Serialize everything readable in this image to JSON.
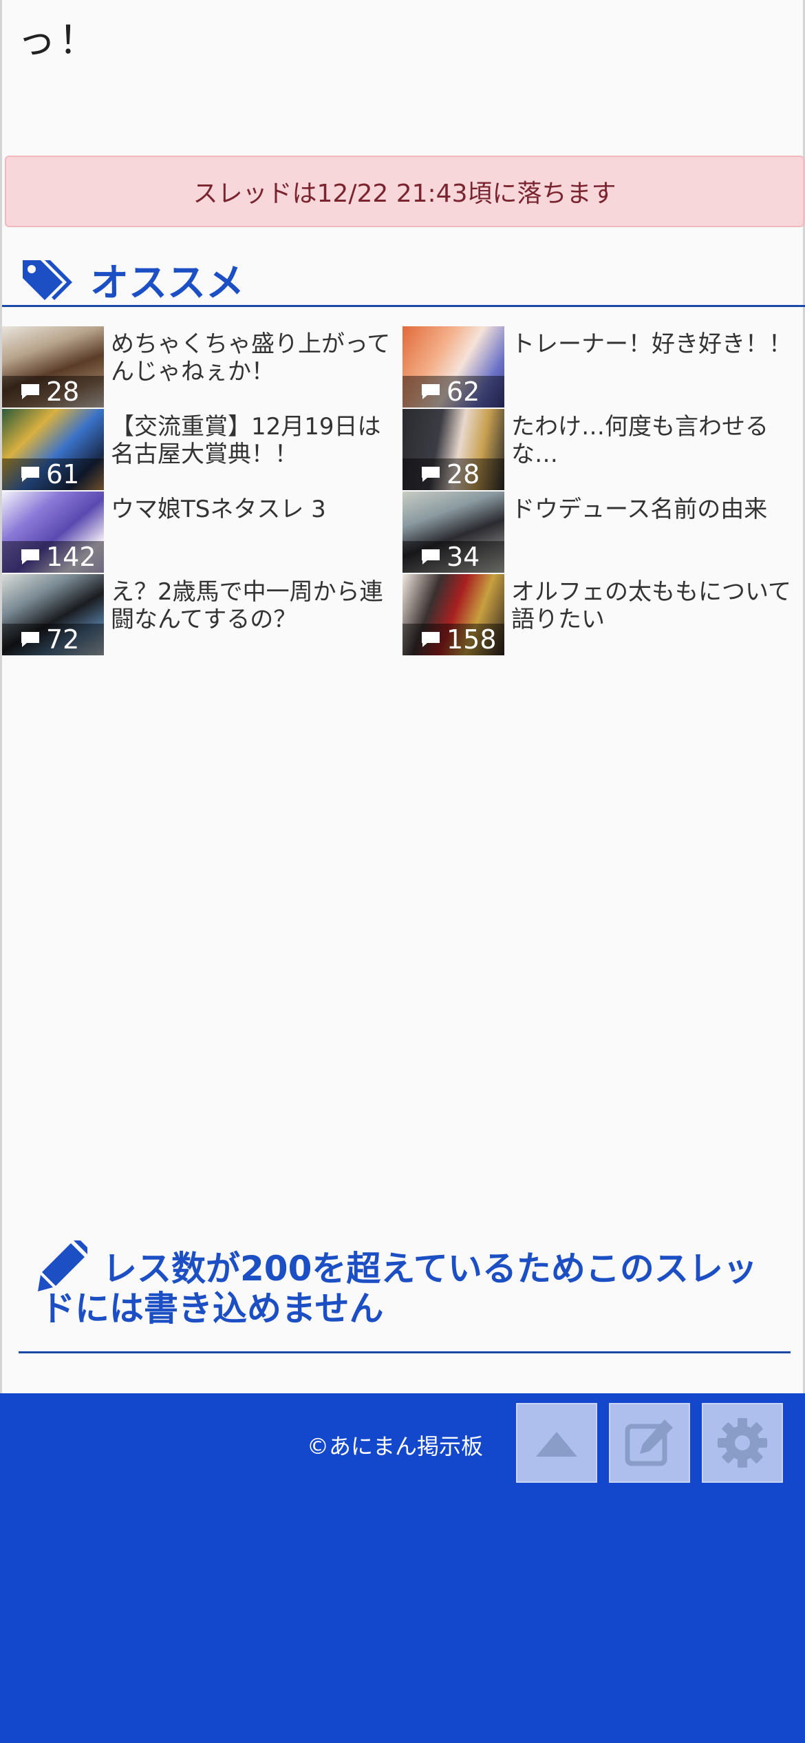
{
  "post_tail": "っ！",
  "alert": {
    "text": "スレッドは12/22 21:43頃に落ちます"
  },
  "recommend": {
    "title": "オススメ",
    "items": [
      {
        "title": "めちゃくちゃ盛り上がってんじゃねぇか！",
        "count": "28"
      },
      {
        "title": "トレーナー！好き好き！！",
        "count": "62"
      },
      {
        "title": "【交流重賞】12月19日は名古屋大賞典！！",
        "count": "61"
      },
      {
        "title": "たわけ…何度も言わせるな…",
        "count": "28"
      },
      {
        "title": "ウマ娘TSネタスレ 3",
        "count": "142"
      },
      {
        "title": "ドウデュース名前の由来",
        "count": "34"
      },
      {
        "title": "え？2歳馬で中一周から連闘なんてするの？",
        "count": "72"
      },
      {
        "title": "オルフェの太ももについて語りたい",
        "count": "158"
      }
    ]
  },
  "notice": {
    "text": "レス数が200を超えているためこのスレッドには書き込めません"
  },
  "footer": {
    "copyright": "©あにまん掲示板",
    "buttons": [
      "scroll-top",
      "write",
      "settings"
    ]
  },
  "colors": {
    "brand": "#1347cc",
    "heading": "#1d4fc4",
    "alert_bg": "#f8d7da"
  }
}
